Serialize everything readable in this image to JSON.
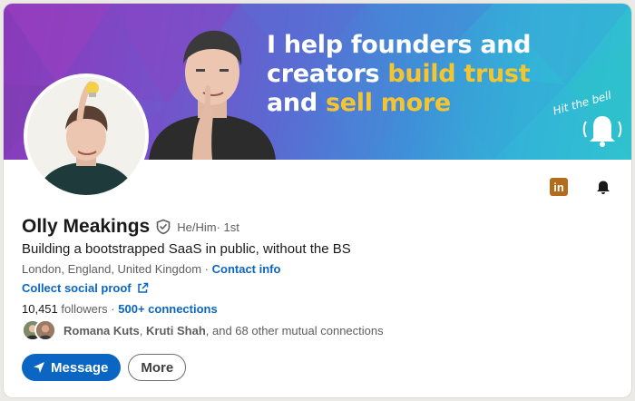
{
  "banner": {
    "headline_line1": "I help founders and",
    "headline_line2_a": "creators ",
    "headline_line2_b": "build trust",
    "headline_line3_a": "and ",
    "headline_line3_b": "sell more",
    "bell_callout": "Hit the bell",
    "accent_color": "#f5c531"
  },
  "profile": {
    "name": "Olly Meakings",
    "pronouns": "He/Him",
    "degree": " · 1st",
    "tagline": "Building a bootstrapped SaaS in public, without the BS",
    "location": "London, England, United Kingdom",
    "location_sep": " · ",
    "contact_info": "Contact info",
    "website_link": "Collect social proof",
    "followers_count": "10,451",
    "followers_label": " followers",
    "stats_sep": " · ",
    "connections": "500+ connections",
    "mutual_name_1": "Romana Kuts",
    "mutual_sep": ", ",
    "mutual_name_2": "Kruti Shah",
    "mutual_rest": ", and 68 other mutual connections"
  },
  "actions": {
    "message_label": "Message",
    "more_label": "More"
  },
  "icons": {
    "linkedin_badge": "in",
    "brand_color": "#0a66c2"
  }
}
